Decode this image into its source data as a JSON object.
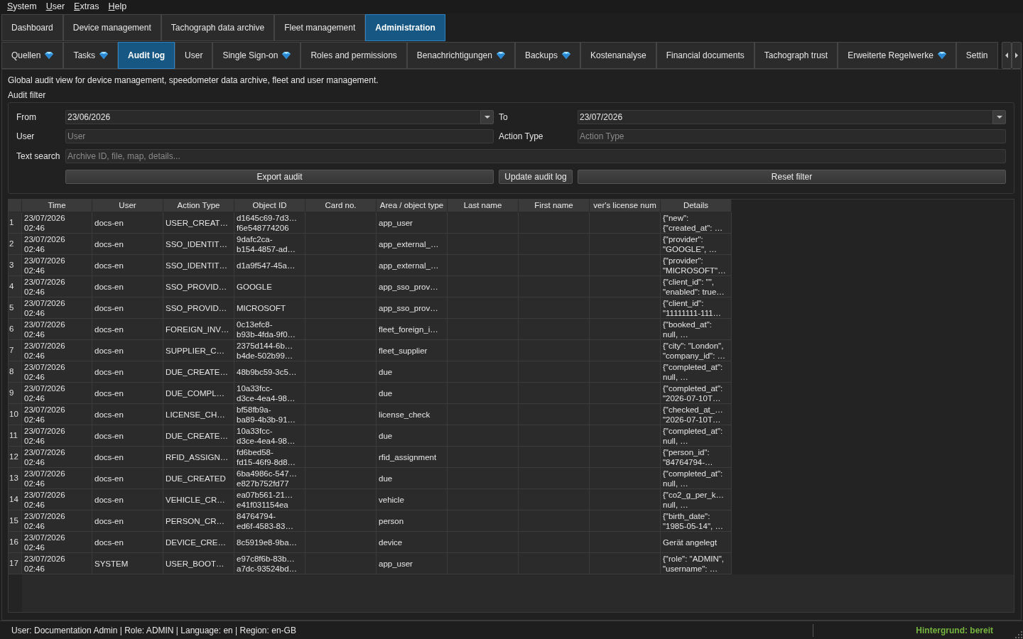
{
  "menu": [
    "System",
    "User",
    "Extras",
    "Help"
  ],
  "main_tabs": [
    {
      "label": "Dashboard",
      "selected": false
    },
    {
      "label": "Device management",
      "selected": false
    },
    {
      "label": "Tachograph data archive",
      "selected": false
    },
    {
      "label": "Fleet management",
      "selected": false
    },
    {
      "label": "Administration",
      "selected": true
    }
  ],
  "sub_tabs": [
    {
      "label": "Quellen",
      "selected": false,
      "premium": true
    },
    {
      "label": "Tasks",
      "selected": false,
      "premium": true
    },
    {
      "label": "Audit log",
      "selected": true,
      "premium": false
    },
    {
      "label": "User",
      "selected": false,
      "premium": false
    },
    {
      "label": "Single Sign-on",
      "selected": false,
      "premium": true
    },
    {
      "label": "Roles and permissions",
      "selected": false,
      "premium": false
    },
    {
      "label": "Benachrichtigungen",
      "selected": false,
      "premium": true
    },
    {
      "label": "Backups",
      "selected": false,
      "premium": true
    },
    {
      "label": "Kostenanalyse",
      "selected": false,
      "premium": false
    },
    {
      "label": "Financial documents",
      "selected": false,
      "premium": false
    },
    {
      "label": "Tachograph trust",
      "selected": false,
      "premium": false
    },
    {
      "label": "Erweiterte Regelwerke",
      "selected": false,
      "premium": true
    },
    {
      "label": "Settin",
      "selected": false,
      "premium": false
    }
  ],
  "description": "Global audit view for device management, speedometer data archive, fleet and user management.",
  "audit_filter": {
    "title": "Audit filter",
    "from": {
      "label": "From",
      "value": "23/06/2026"
    },
    "to": {
      "label": "To",
      "value": "23/07/2026"
    },
    "user": {
      "label": "User",
      "placeholder": "User"
    },
    "action_type": {
      "label": "Action Type",
      "placeholder": "Action Type"
    },
    "text_search": {
      "label": "Text search",
      "placeholder": "Archive ID, file, map, details..."
    },
    "buttons": [
      "Export audit",
      "Update audit log",
      "Reset filter"
    ]
  },
  "table": {
    "columns": [
      "Time",
      "User",
      "Action Type",
      "Object ID",
      "Card no.",
      "Area / object type",
      "Last name",
      "First name",
      "ver's license num",
      "Details"
    ],
    "rows": [
      {
        "number": "1",
        "time": "23/07/2026\n02:46",
        "user": "docs-en",
        "action_type": "USER_CREAT…",
        "object_id": "d1645c69-7d3…\nf6e548774206",
        "area_object_type": "app_user",
        "details": "{\"new\":\n{\"created_at\": …"
      },
      {
        "number": "2",
        "time": "23/07/2026\n02:46",
        "user": "docs-en",
        "action_type": "SSO_IDENTIT…",
        "object_id": "9dafc2ca-\nb154-4857-ad…",
        "area_object_type": "app_external_…",
        "details": "{\"provider\":\n\"GOOGLE\", …"
      },
      {
        "number": "3",
        "time": "23/07/2026\n02:46",
        "user": "docs-en",
        "action_type": "SSO_IDENTIT…",
        "object_id": "d1a9f547-45a…",
        "area_object_type": "app_external_…",
        "details": "{\"provider\":\n\"MICROSOFT\"…"
      },
      {
        "number": "4",
        "time": "23/07/2026\n02:46",
        "user": "docs-en",
        "action_type": "SSO_PROVID…",
        "object_id": "GOOGLE",
        "area_object_type": "app_sso_prov…",
        "details": "{\"client_id\": \"\",\n\"enabled\": true…"
      },
      {
        "number": "5",
        "time": "23/07/2026\n02:46",
        "user": "docs-en",
        "action_type": "SSO_PROVID…",
        "object_id": "MICROSOFT",
        "area_object_type": "app_sso_prov…",
        "details": "{\"client_id\":\n\"11111111-111…"
      },
      {
        "number": "6",
        "time": "23/07/2026\n02:46",
        "user": "docs-en",
        "action_type": "FOREIGN_INV…",
        "object_id": "0c13efc8-\nb93b-4fda-9f0…",
        "area_object_type": "fleet_foreign_i…",
        "details": "{\"booked_at\":\nnull, …"
      },
      {
        "number": "7",
        "time": "23/07/2026\n02:46",
        "user": "docs-en",
        "action_type": "SUPPLIER_C…",
        "object_id": "2375d144-6b…\nb4de-502b99…",
        "area_object_type": "fleet_supplier",
        "details": "{\"city\": \"London\",\n\"company_id\": …"
      },
      {
        "number": "8",
        "time": "23/07/2026\n02:46",
        "user": "docs-en",
        "action_type": "DUE_CREATE…",
        "object_id": "48b9bc59-3c5…",
        "area_object_type": "due",
        "details": "{\"completed_at\":\nnull, …"
      },
      {
        "number": "9",
        "time": "23/07/2026\n02:46",
        "user": "docs-en",
        "action_type": "DUE_COMPL…",
        "object_id": "10a33fcc-\nd3ce-4ea4-98…",
        "area_object_type": "due",
        "details": "{\"completed_at\":\n\"2026-07-10T…"
      },
      {
        "number": "10",
        "time": "23/07/2026\n02:46",
        "user": "docs-en",
        "action_type": "LICENSE_CH…",
        "object_id": "bf58fb9a-\nba89-4b3b-91…",
        "area_object_type": "license_check",
        "details": "{\"checked_at_…\n\"2026-07-10T…"
      },
      {
        "number": "11",
        "time": "23/07/2026\n02:46",
        "user": "docs-en",
        "action_type": "DUE_CREATE…",
        "object_id": "10a33fcc-\nd3ce-4ea4-98…",
        "area_object_type": "due",
        "details": "{\"completed_at\":\nnull, …"
      },
      {
        "number": "12",
        "time": "23/07/2026\n02:46",
        "user": "docs-en",
        "action_type": "RFID_ASSIGN…",
        "object_id": "fd6bed58-\nfd15-46f9-8d8…",
        "area_object_type": "rfid_assignment",
        "details": "{\"person_id\":\n\"84764794-…"
      },
      {
        "number": "13",
        "time": "23/07/2026\n02:46",
        "user": "docs-en",
        "action_type": "DUE_CREATED",
        "object_id": "6ba4986c-547…\ne827b752fd77",
        "area_object_type": "due",
        "details": "{\"completed_at\":\nnull, …"
      },
      {
        "number": "14",
        "time": "23/07/2026\n02:46",
        "user": "docs-en",
        "action_type": "VEHICLE_CR…",
        "object_id": "ea07b561-21…\ne41f031154ea",
        "area_object_type": "vehicle",
        "details": "{\"co2_g_per_k…\nnull, …"
      },
      {
        "number": "15",
        "time": "23/07/2026\n02:46",
        "user": "docs-en",
        "action_type": "PERSON_CR…",
        "object_id": "84764794-\ned6f-4583-83…",
        "area_object_type": "person",
        "details": "{\"birth_date\":\n\"1985-05-14\", …"
      },
      {
        "number": "16",
        "time": "23/07/2026\n02:46",
        "user": "docs-en",
        "action_type": "DEVICE_CRE…",
        "object_id": "8c5919e8-9ba…",
        "area_object_type": "device",
        "details": "Gerät angelegt"
      },
      {
        "number": "17",
        "time": "23/07/2026\n02:46",
        "user": "SYSTEM",
        "action_type": "USER_BOOT…",
        "object_id": "e97c8f6b-83b…\na7dc-93524bd…",
        "area_object_type": "app_user",
        "details": "{\"role\": \"ADMIN\",\n\"username\": …"
      }
    ]
  },
  "status_bar": {
    "info": "User: Documentation Admin | Role: ADMIN | Language: en | Region: en-GB",
    "background_status": "Hintergrund: bereit"
  }
}
